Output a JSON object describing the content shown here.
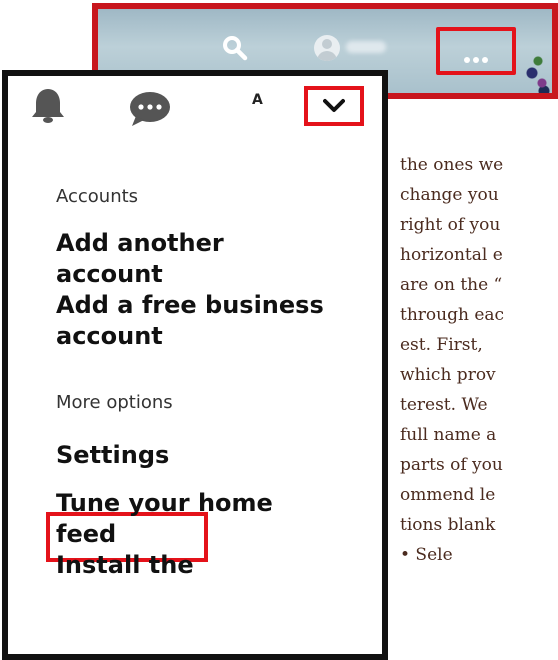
{
  "top_bar": {
    "icons": [
      "search-icon",
      "avatar",
      "more-options-icon"
    ]
  },
  "panel": {
    "account_initial": "A",
    "icons": [
      "notifications-bell-icon",
      "messages-chat-icon",
      "chevron-down-icon"
    ],
    "accounts_heading": "Accounts",
    "accounts_items": [
      {
        "line1": "Add another",
        "line2": "account"
      },
      {
        "line1": "Add a free business",
        "line2": "account"
      }
    ],
    "more_options_heading": "More options",
    "more_options_items": [
      {
        "line1": "Settings"
      },
      {
        "line1": "Tune your home",
        "line2": "feed"
      },
      {
        "line1": "Install the"
      }
    ]
  },
  "article_lines": [
    "the ones we",
    "change you",
    "right of you",
    "horizontal e",
    "are on the “",
    "through eac",
    "est.   First,",
    "which prov",
    "terest.    We",
    "full name a",
    "parts of you",
    "ommend le",
    "tions  blank",
    "•   Sele"
  ],
  "colors": {
    "highlight_red": "#e4121a",
    "panel_border": "#111111",
    "article_text": "#4b2b1f"
  }
}
